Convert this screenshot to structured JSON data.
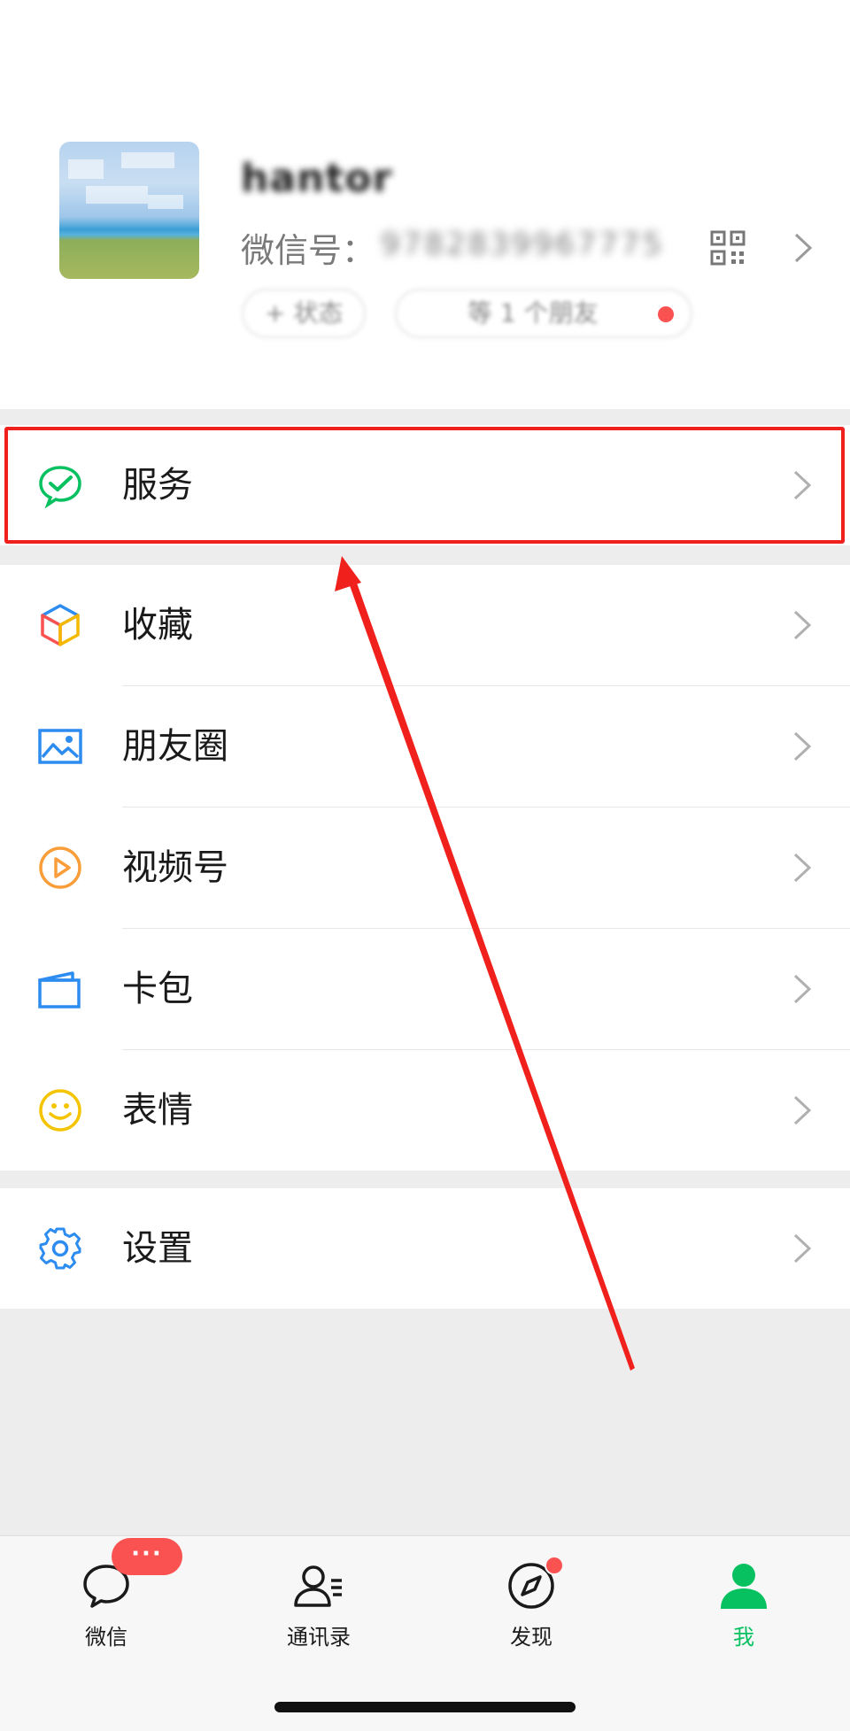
{
  "profile": {
    "nickname": "hantor",
    "wxid_label": "微信号：",
    "wxid_value": "9782839967775",
    "status_pill": "+ 状态",
    "friends_pill": "等 1 个朋友"
  },
  "menu": {
    "service": "服务",
    "favorites": "收藏",
    "moments": "朋友圈",
    "channels": "视频号",
    "cards": "卡包",
    "stickers": "表情",
    "settings": "设置"
  },
  "tabs": [
    {
      "label": "微信",
      "badge": "···"
    },
    {
      "label": "通讯录"
    },
    {
      "label": "发现"
    },
    {
      "label": "我"
    }
  ],
  "colors": {
    "accent": "#07c160",
    "highlight": "#f0201c",
    "badge": "#fa5151"
  }
}
